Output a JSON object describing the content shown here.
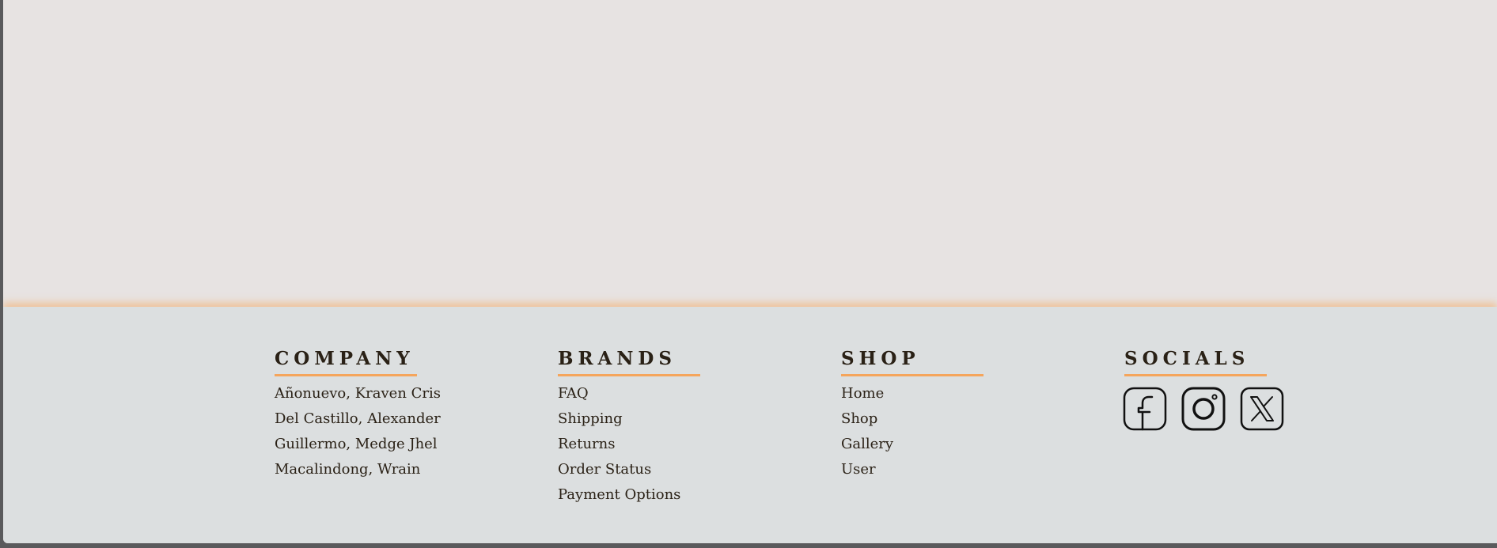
{
  "footer": {
    "company": {
      "heading": "COMPANY",
      "items": [
        {
          "label": "Añonuevo, Kraven Cris"
        },
        {
          "label": "Del Castillo, Alexander"
        },
        {
          "label": "Guillermo, Medge Jhel"
        },
        {
          "label": "Macalindong, Wrain"
        }
      ]
    },
    "brands": {
      "heading": "BRANDS",
      "items": [
        {
          "label": "FAQ"
        },
        {
          "label": "Shipping"
        },
        {
          "label": "Returns"
        },
        {
          "label": "Order Status"
        },
        {
          "label": "Payment Options"
        }
      ]
    },
    "shop": {
      "heading": "SHOP",
      "items": [
        {
          "label": "Home"
        },
        {
          "label": "Shop"
        },
        {
          "label": "Gallery"
        },
        {
          "label": "User"
        }
      ]
    },
    "socials": {
      "heading": "SOCIALS",
      "icons": [
        "facebook-icon",
        "instagram-icon",
        "x-icon"
      ]
    }
  },
  "colors": {
    "page_background": "#e7e3e2",
    "footer_background": "#dcdfe0",
    "accent": "#f5a55c",
    "text": "#2a2116"
  }
}
